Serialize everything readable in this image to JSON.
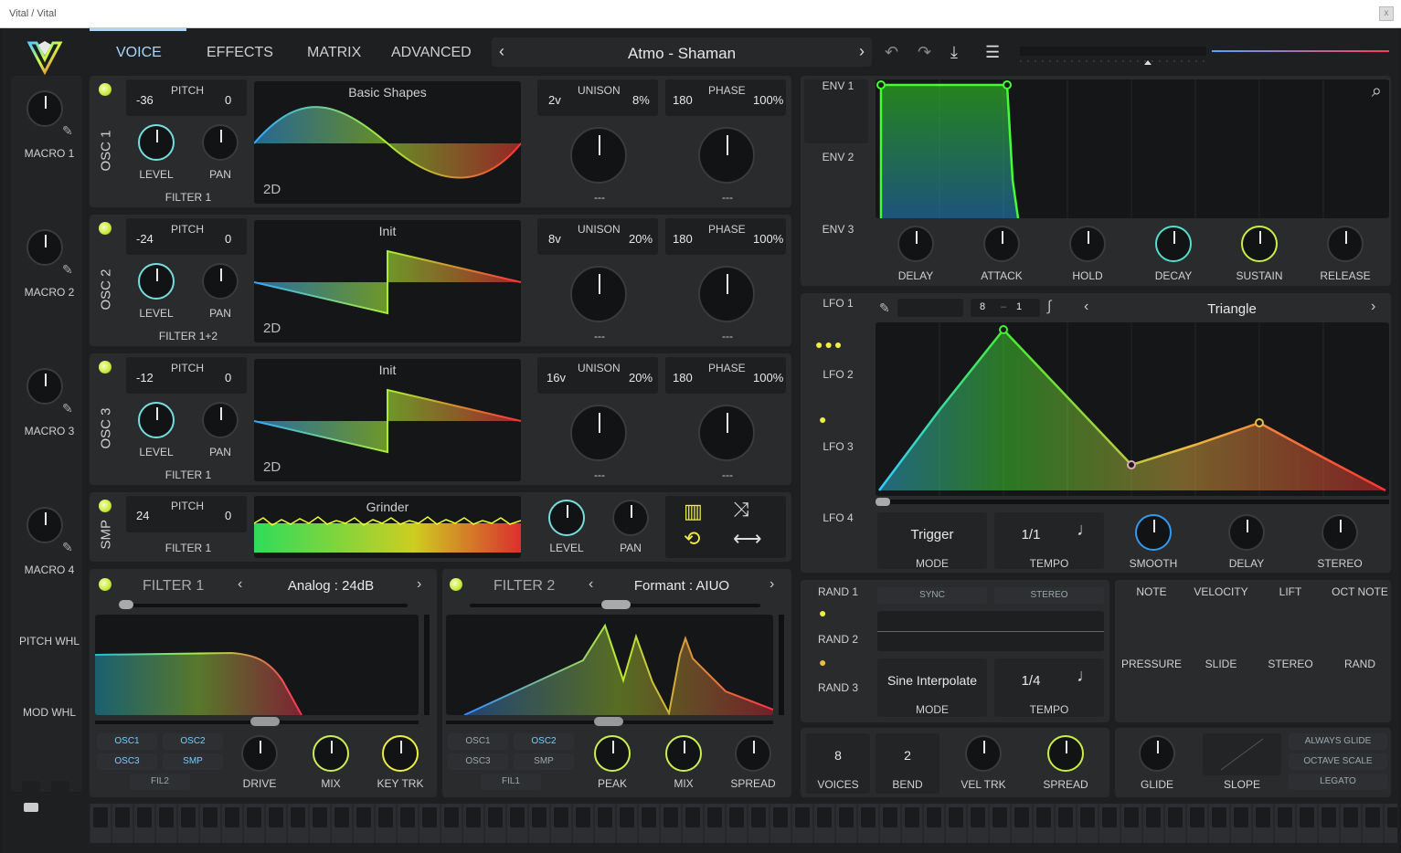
{
  "window": {
    "title": "Vital / Vital"
  },
  "tabs": [
    "VOICE",
    "EFFECTS",
    "MATRIX",
    "ADVANCED"
  ],
  "preset": {
    "name": "Atmo - Shaman"
  },
  "macros": [
    "MACRO 1",
    "MACRO 2",
    "MACRO 3",
    "MACRO 4"
  ],
  "wheels": [
    "PITCH WHL",
    "MOD WHL"
  ],
  "osc": [
    {
      "label": "OSC 1",
      "pitch_low": "-36",
      "pitch_label": "PITCH",
      "pitch_high": "0",
      "level": "LEVEL",
      "pan": "PAN",
      "filter": "FILTER 1",
      "wavetable": "Basic Shapes",
      "mode": "2D",
      "unison_voices": "2v",
      "unison_label": "UNISON",
      "unison_detune": "8%",
      "phase_val": "180",
      "phase_label": "PHASE",
      "phase_rand": "100%",
      "sel1": "---",
      "sel2": "---"
    },
    {
      "label": "OSC 2",
      "pitch_low": "-24",
      "pitch_label": "PITCH",
      "pitch_high": "0",
      "level": "LEVEL",
      "pan": "PAN",
      "filter": "FILTER 1+2",
      "wavetable": "Init",
      "mode": "2D",
      "unison_voices": "8v",
      "unison_label": "UNISON",
      "unison_detune": "20%",
      "phase_val": "180",
      "phase_label": "PHASE",
      "phase_rand": "100%",
      "sel1": "---",
      "sel2": "---"
    },
    {
      "label": "OSC 3",
      "pitch_low": "-12",
      "pitch_label": "PITCH",
      "pitch_high": "0",
      "level": "LEVEL",
      "pan": "PAN",
      "filter": "FILTER 1",
      "wavetable": "Init",
      "mode": "2D",
      "unison_voices": "16v",
      "unison_label": "UNISON",
      "unison_detune": "20%",
      "phase_val": "180",
      "phase_label": "PHASE",
      "phase_rand": "100%",
      "sel1": "---",
      "sel2": "---"
    }
  ],
  "smp": {
    "label": "SMP",
    "pitch_low": "24",
    "pitch_label": "PITCH",
    "pitch_high": "0",
    "filter": "FILTER 1",
    "sample": "Grinder",
    "level": "LEVEL",
    "pan": "PAN"
  },
  "filter1": {
    "title": "FILTER 1",
    "type": "Analog : 24dB",
    "routes": [
      "OSC1",
      "OSC2",
      "OSC3",
      "SMP"
    ],
    "fil": "FIL2",
    "knobs": [
      "DRIVE",
      "MIX",
      "KEY TRK"
    ]
  },
  "filter2": {
    "title": "FILTER 2",
    "type": "Formant : AIUO",
    "routes": [
      "OSC1",
      "OSC2",
      "OSC3",
      "SMP"
    ],
    "fil": "FIL1",
    "knobs": [
      "PEAK",
      "MIX",
      "SPREAD"
    ]
  },
  "env": {
    "tabs": [
      "ENV 1",
      "ENV 2",
      "ENV 3"
    ],
    "knobs": [
      "DELAY",
      "ATTACK",
      "HOLD",
      "DECAY",
      "SUSTAIN",
      "RELEASE"
    ]
  },
  "lfo": {
    "tabs": [
      "LFO 1",
      "LFO 2",
      "LFO 3",
      "LFO 4"
    ],
    "grid_x": "8",
    "grid_sep": "–",
    "grid_y": "1",
    "shape": "Triangle",
    "mode_val": "Trigger",
    "mode_label": "MODE",
    "tempo_val": "1/1",
    "tempo_label": "TEMPO",
    "knobs": [
      "SMOOTH",
      "DELAY",
      "STEREO"
    ]
  },
  "rand": {
    "tabs": [
      "RAND 1",
      "RAND 2",
      "RAND 3"
    ],
    "sync": "SYNC",
    "stereo": "STEREO",
    "mode_val": "Sine Interpolate",
    "mode_label": "MODE",
    "tempo_val": "1/4",
    "tempo_label": "TEMPO"
  },
  "mod_sources": [
    "NOTE",
    "VELOCITY",
    "LIFT",
    "OCT NOTE",
    "PRESSURE",
    "SLIDE",
    "STEREO",
    "RAND"
  ],
  "voice": {
    "voices_val": "8",
    "voices": "VOICES",
    "bend_val": "2",
    "bend": "BEND",
    "vel_trk": "VEL TRK",
    "spread": "SPREAD"
  },
  "glide": {
    "glide": "GLIDE",
    "slope": "SLOPE",
    "always": "ALWAYS GLIDE",
    "octave": "OCTAVE SCALE",
    "legato": "LEGATO"
  }
}
